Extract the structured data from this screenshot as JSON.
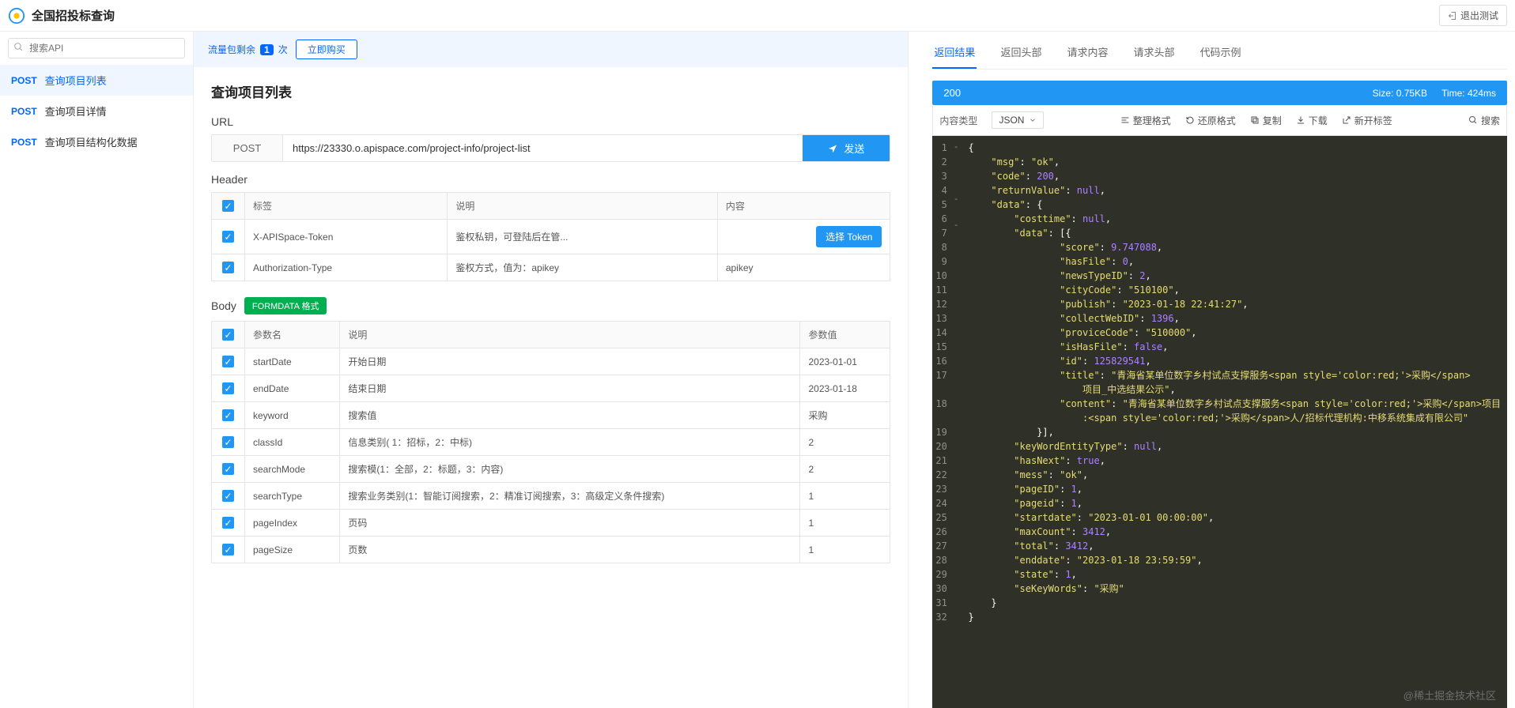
{
  "topbar": {
    "title": "全国招投标查询",
    "exit": "退出测试"
  },
  "sidebar": {
    "search_placeholder": "搜索API",
    "items": [
      {
        "method": "POST",
        "label": "查询项目列表"
      },
      {
        "method": "POST",
        "label": "查询项目详情"
      },
      {
        "method": "POST",
        "label": "查询项目结构化数据"
      }
    ]
  },
  "quota": {
    "prefix": "流量包剩余",
    "count": "1",
    "suffix": "次",
    "buy": "立即购买"
  },
  "main": {
    "title": "查询项目列表",
    "url_label": "URL",
    "method": "POST",
    "url": "https://23330.o.apispace.com/project-info/project-list",
    "send": "发送",
    "header_label": "Header",
    "header_cols": {
      "c1": "标签",
      "c2": "说明",
      "c3": "内容"
    },
    "headers": [
      {
        "tag": "X-APISpace-Token",
        "desc": "鉴权私钥，可登陆后在管...",
        "content": "",
        "btn": "选择 Token"
      },
      {
        "tag": "Authorization-Type",
        "desc": "鉴权方式，值为：apikey",
        "content": "apikey"
      }
    ],
    "body_label": "Body",
    "format_badge": "FORMDATA 格式",
    "body_cols": {
      "c1": "参数名",
      "c2": "说明",
      "c3": "参数值"
    },
    "body_params": [
      {
        "name": "startDate",
        "desc": "开始日期",
        "value": "2023-01-01"
      },
      {
        "name": "endDate",
        "desc": "结束日期",
        "value": "2023-01-18"
      },
      {
        "name": "keyword",
        "desc": "搜索值",
        "value": "采购"
      },
      {
        "name": "classId",
        "desc": "信息类别( 1：招标，2：中标)",
        "value": "2"
      },
      {
        "name": "searchMode",
        "desc": "搜索模(1：全部，2：标题，3：内容)",
        "value": "2"
      },
      {
        "name": "searchType",
        "desc": "搜索业务类别(1：智能订阅搜索，2：精准订阅搜索，3：高级定义条件搜索)",
        "value": "1"
      },
      {
        "name": "pageIndex",
        "desc": "页码",
        "value": "1"
      },
      {
        "name": "pageSize",
        "desc": "页数",
        "value": "1"
      }
    ]
  },
  "right": {
    "tabs": [
      "返回结果",
      "返回头部",
      "请求内容",
      "请求头部",
      "代码示例"
    ],
    "status_code": "200",
    "size_label": "Size:",
    "size_value": "0.75KB",
    "time_label": "Time:",
    "time_value": "424ms",
    "content_type_label": "内容类型",
    "content_type_value": "JSON",
    "tools": {
      "format": "整理格式",
      "restore": "还原格式",
      "copy": "复制",
      "download": "下载",
      "newtab": "新开标签",
      "search": "搜索"
    }
  },
  "response_json": {
    "msg": "ok",
    "code": 200,
    "returnValue": null,
    "data": {
      "costtime": null,
      "data": [
        {
          "score": 9.747088,
          "hasFile": 0,
          "newsTypeID": 2,
          "cityCode": "510100",
          "publish": "2023-01-18 22:41:27",
          "collectWebID": 1396,
          "proviceCode": "510000",
          "isHasFile": false,
          "id": 125829541,
          "title": "青海省某单位数字乡村试点支撑服务<span style='color:red;'>采购</span>项目_中选结果公示",
          "content": "青海省某单位数字乡村试点支撑服务<span style='color:red;'>采购</span>项目:<span style='color:red;'>采购</span>人/招标代理机构:中移系统集成有限公司"
        }
      ],
      "keyWordEntityType": null,
      "hasNext": true,
      "mess": "ok",
      "pageID": 1,
      "pageid": 1,
      "startdate": "2023-01-01 00:00:00",
      "maxCount": 3412,
      "total": 3412,
      "enddate": "2023-01-18 23:59:59",
      "state": 1,
      "seKeyWords": "采购"
    }
  },
  "watermark": "@稀土掘金技术社区"
}
